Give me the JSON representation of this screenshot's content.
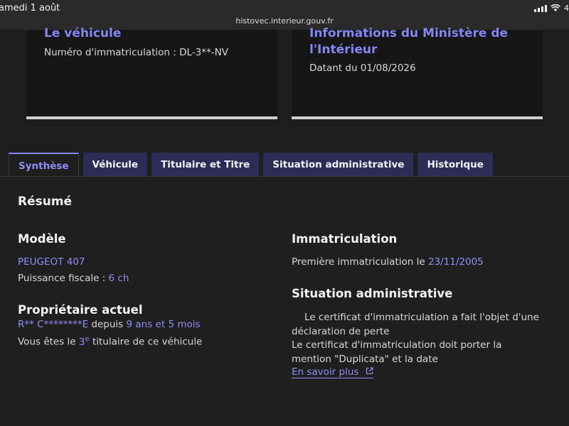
{
  "statusbar": {
    "time": "amedi 1 août",
    "url": "histovec.interieur.gouv.fr",
    "battery": "4"
  },
  "cards": {
    "vehicle": {
      "title": "Le véhicule",
      "plate_label": "Numéro d'immatriculation : DL-3**-NV"
    },
    "ministry": {
      "title": "Informations du Ministère de l'Intérieur",
      "date": "Datant du 01/08/2026"
    }
  },
  "tabs": [
    "Synthèse",
    "Véhicule",
    "Titulaire et Titre",
    "Situation administrative",
    "Historique"
  ],
  "summary": {
    "title": "Résumé",
    "model": {
      "heading": "Modèle",
      "name": "PEUGEOT 407",
      "power_label": "Puissance fiscale : ",
      "power_value": "6 ch"
    },
    "owner": {
      "heading": "Propriétaire actuel",
      "name": "R** C********E",
      "since_label": " depuis ",
      "since_value": "9 ans et 5 mois",
      "rank_prefix": "Vous êtes le ",
      "rank_number": "3",
      "rank_sup": "e",
      "rank_suffix": " titulaire de ce véhicule"
    },
    "registration": {
      "heading": "Immatriculation",
      "first_label": "Première immatriculation le ",
      "first_date": "23/11/2005"
    },
    "admin": {
      "heading": "Situation administrative",
      "line1": "Le certificat d'immatriculation a fait l'objet d'une déclaration de perte",
      "line2": "Le certificat d'immatriculation doit porter la mention \"Duplicata\" et la date",
      "more": "En savoir plus"
    }
  },
  "colors": {
    "accent": "#8585f6",
    "tab_bg": "#2c2c57",
    "background": "#1e1e1e"
  }
}
